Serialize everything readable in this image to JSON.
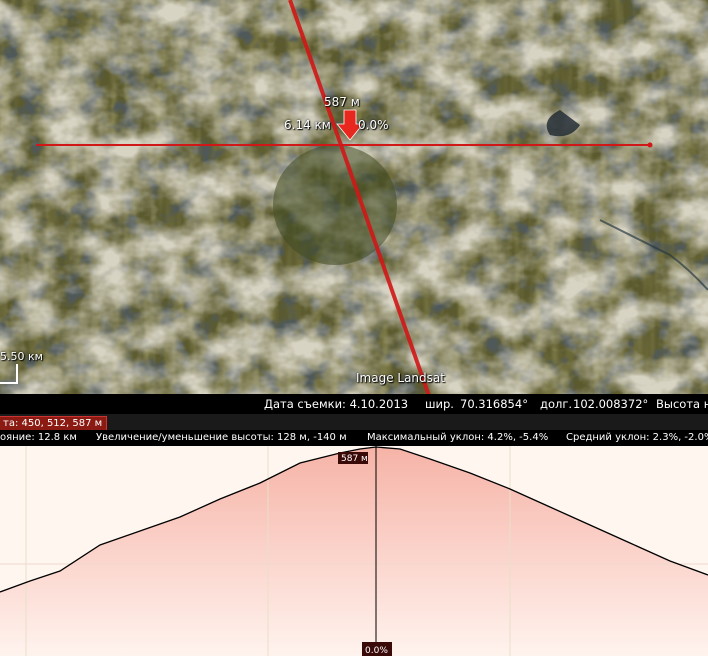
{
  "map": {
    "marker_elevation": "587 м",
    "marker_distance": "6.14 км",
    "marker_slope": "0.0%",
    "imagery_credit": "Image Landsat",
    "scale_label": "5.50 км"
  },
  "info_bar": {
    "date": "Дата съемки: 4.10.2013",
    "lat_label": "шир.",
    "lat_value": "70.316854°",
    "lon_label": "долг.",
    "lon_value": "102.008372°",
    "alt_label": "Высота н"
  },
  "profile": {
    "readout": "та: 450, 512, 587 м",
    "distance": "ояние: 12.8 км",
    "elevation_change": "Увеличение/уменьшение высоты: 128 м, -140 м",
    "max_slope": "Максимальный уклон: 4.2%, -5.4%",
    "avg_slope": "Средний уклон: 2.3%, -2.0%",
    "cursor_elevation": "587 м",
    "cursor_slope": "0.0%",
    "colors": {
      "fill_top": "#f6b3a7",
      "fill_bottom": "#fff3ee",
      "line": "#000000",
      "cursor": "#000000"
    }
  }
}
